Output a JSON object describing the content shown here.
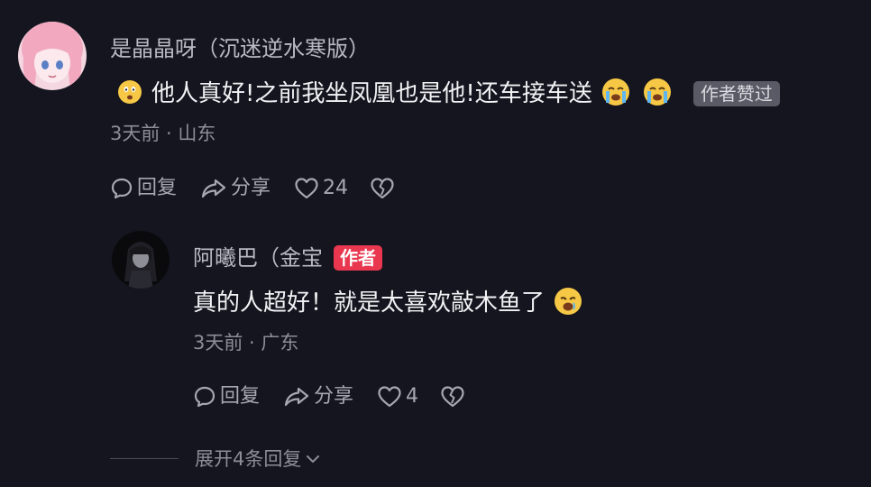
{
  "comment": {
    "username": "是晶晶呀（沉迷逆水寒版）",
    "text": "他人真好!之前我坐凤凰也是他!还车接车送",
    "badge": "作者赞过",
    "meta": "3天前 · 山东",
    "actions": {
      "reply": "回复",
      "share": "分享",
      "like_count": "24"
    }
  },
  "reply": {
    "username": "阿曦巴（金宝",
    "author_badge": "作者",
    "text": "真的人超好！就是太喜欢敲木鱼了",
    "meta": "3天前 · 广东",
    "actions": {
      "reply": "回复",
      "share": "分享",
      "like_count": "4"
    }
  },
  "expand_replies": "展开4条回复",
  "colors": {
    "background": "#15151f",
    "author_badge": "#e8374e",
    "liked_badge": "#5a5a66"
  }
}
